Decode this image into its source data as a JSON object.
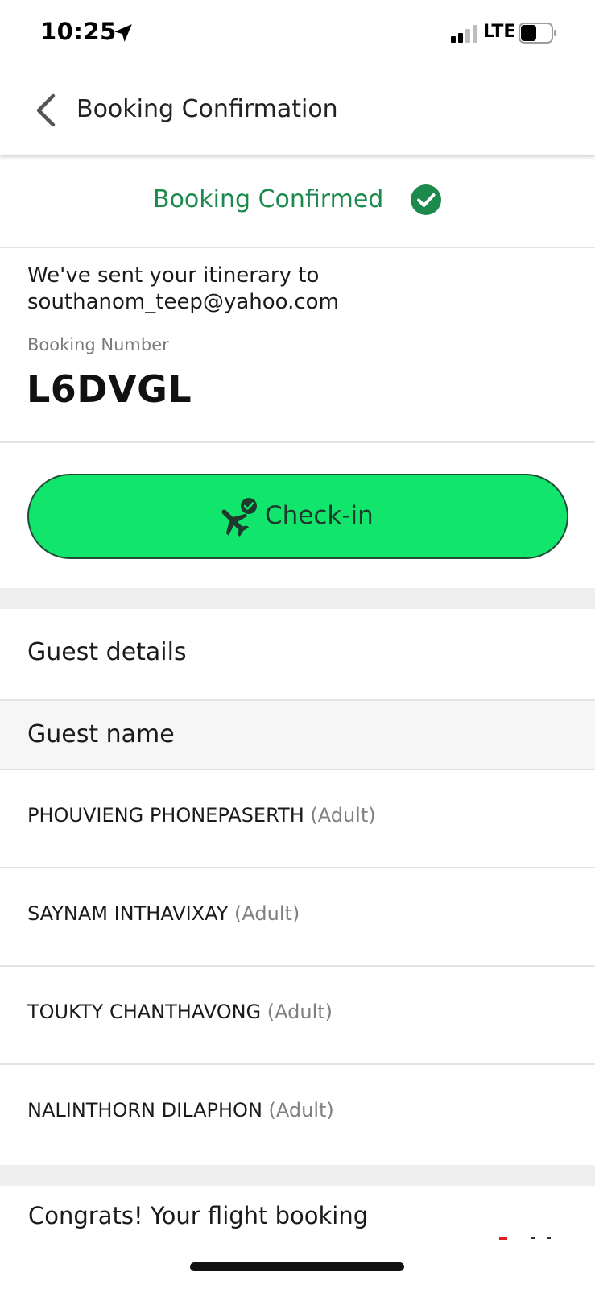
{
  "status_bar": {
    "time": "10:25",
    "network": "LTE",
    "battery": "44"
  },
  "header": {
    "title": "Booking Confirmation"
  },
  "banner": {
    "text": "Booking Confirmed",
    "color": "#1c8a4c"
  },
  "itinerary": {
    "sent_text": "We've sent your itinerary to southanom_teep@yahoo.com",
    "booking_number_label": "Booking Number",
    "booking_number": "L6DVGL"
  },
  "checkin": {
    "label": "Check-in",
    "color": "#12e56c"
  },
  "guests": {
    "title": "Guest details",
    "column_header": "Guest name",
    "list": [
      {
        "name": "PHOUVIENG PHONEPASERTH",
        "type": "(Adult)"
      },
      {
        "name": "SAYNAM INTHAVIXAY",
        "type": "(Adult)"
      },
      {
        "name": "TOUKTY CHANTHAVONG",
        "type": "(Adult)"
      },
      {
        "name": "NALINTHORN DILAPHON",
        "type": "(Adult)"
      }
    ]
  },
  "bottom": {
    "congrats": "Congrats! Your flight booking"
  }
}
